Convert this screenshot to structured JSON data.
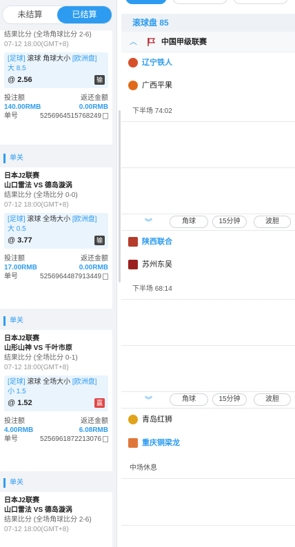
{
  "tabs": [
    {
      "label": "未结算",
      "active": false
    },
    {
      "label": "已结算",
      "active": true
    }
  ],
  "cards": [
    {
      "result": "结果比分 (全场角球比分 2-6)",
      "time": "07-12 18:00(GMT+8)",
      "bet_prefix": "[足球]",
      "bet_type": "滚球 角球大小",
      "bet_market": "[欧洲盘]",
      "selection": "大 8.5",
      "odds": "2.56",
      "outcome": "输",
      "stake_label": "投注额",
      "stake_value": "140.00RMB",
      "return_label": "返还金额",
      "return_value": "0.00RMB",
      "order_label": "单号",
      "order_no": "5256964515768249"
    },
    {
      "section": "单关",
      "league": "日本J2联赛",
      "teams": "山口雷法 VS 德岛漩涡",
      "result": "结果比分 (全场比分 0-0)",
      "time": "07-12 18:00(GMT+8)",
      "bet_prefix": "[足球]",
      "bet_type": "滚球 全场大小",
      "bet_market": "[欧洲盘]",
      "selection": "大 0.5",
      "odds": "3.77",
      "outcome": "输",
      "stake_label": "投注额",
      "stake_value": "17.00RMB",
      "return_label": "返还金额",
      "return_value": "0.00RMB",
      "order_label": "单号",
      "order_no": "5256964487913449"
    },
    {
      "section": "单关",
      "league": "日本J2联赛",
      "teams": "山形山神 VS 千叶市原",
      "result": "结果比分 (全场比分 0-1)",
      "time": "07-12 18:00(GMT+8)",
      "bet_prefix": "[足球]",
      "bet_type": "滚球 全场大小",
      "bet_market": "[欧洲盘]",
      "selection": "小 1.5",
      "odds": "1.52",
      "outcome": "赢",
      "stake_label": "投注额",
      "stake_value": "4.00RMB",
      "return_label": "返还金额",
      "return_value": "6.08RMB",
      "order_label": "单号",
      "order_no": "5256961872213076"
    },
    {
      "section": "单关",
      "league": "日本J2联赛",
      "teams": "山口雷法 VS 德岛漩涡",
      "result": "结果比分 (全场角球比分 2-6)",
      "time": "07-12 18:00(GMT+8)"
    }
  ],
  "live": {
    "title": "滚球盘 85",
    "league": "中国甲级联赛",
    "matches": [
      {
        "home": "辽宁铁人",
        "away": "广西平果",
        "status": "下半场 74:02",
        "home_color": "#d7502a",
        "away_color": "#e06a1a"
      },
      {
        "home": "陕西联合",
        "away": "苏州东吴",
        "status": "下半场 68:14",
        "home_color": "#b53b2b",
        "away_color": "#9c1f1f"
      },
      {
        "home": "青岛红狮",
        "away": "重庆铜梁龙",
        "status": "中场休息",
        "home_color": "#e0a31a",
        "away_color": "#e0773a"
      }
    ],
    "options": [
      "角球",
      "15分钟",
      "波胆"
    ]
  }
}
